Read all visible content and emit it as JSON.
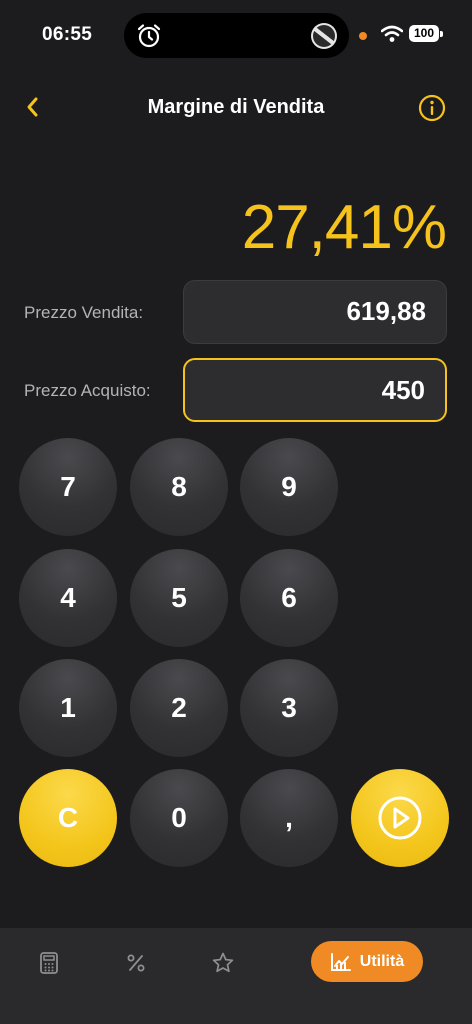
{
  "status_bar": {
    "time": "06:55",
    "battery": "100"
  },
  "header": {
    "title": "Margine di Vendita"
  },
  "result": "27,41%",
  "fields": {
    "selling_price": {
      "label": "Prezzo Vendita:",
      "value": "619,88"
    },
    "purchase_price": {
      "label": "Prezzo Acquisto:",
      "value": "450"
    }
  },
  "keypad": {
    "k7": "7",
    "k8": "8",
    "k9": "9",
    "k4": "4",
    "k5": "5",
    "k6": "6",
    "k1": "1",
    "k2": "2",
    "k3": "3",
    "clear": "C",
    "k0": "0",
    "comma": ","
  },
  "tabbar": {
    "active_label": "Utilità"
  },
  "colors": {
    "accent": "#f5c31c",
    "tab_active": "#f08a24",
    "background": "#1c1c1e"
  }
}
